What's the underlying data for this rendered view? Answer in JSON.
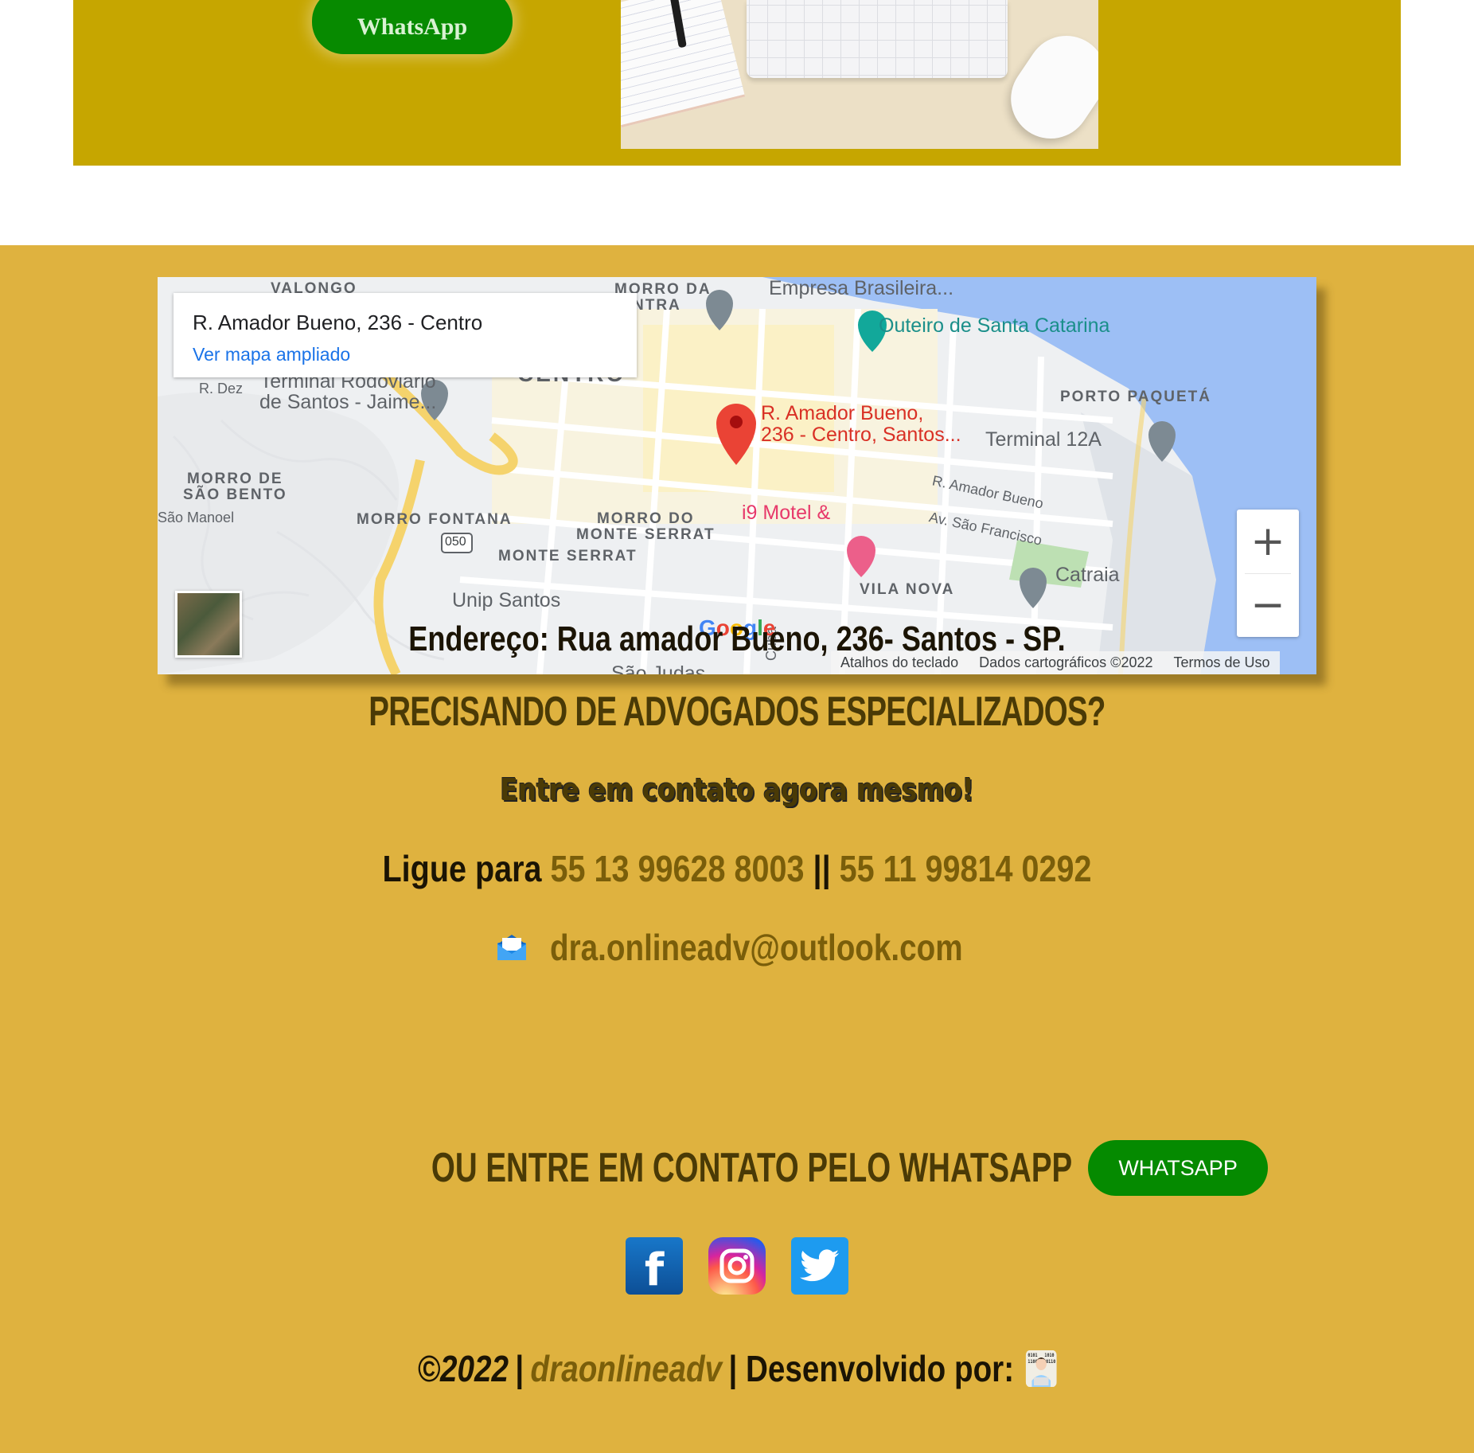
{
  "top_banner": {
    "whatsapp_button": "WhatsApp",
    "colors": {
      "banner": "#c6a600",
      "button": "#078a00"
    }
  },
  "map": {
    "info_address": "R. Amador Bueno, 236 - Centro",
    "info_link": "Ver mapa ampliado",
    "labels": {
      "valongo": "VALONGO",
      "morro_da_cintra": "MORRO DA\nCINTRA",
      "empresa": "Empresa Brasileira...",
      "outeiro": "Outeiro de Santa Catarina",
      "centro": "CENTRO",
      "terminal_rodoviario": "Terminal Rodoviário\nde Santos - Jaime...",
      "r_dez": "R. Dez",
      "porto_paqueta": "PORTO PAQUETÁ",
      "pin_label": "R. Amador Bueno,\n236 - Centro, Santos...",
      "terminal_12a": "Terminal 12A",
      "morro_sao_bento": "MORRO DE\nSÃO BENTO",
      "route_050": "050",
      "sao_manoel": "São Manoel",
      "morro_fontana": "MORRO FONTANA",
      "morro_monte_serrat": "MORRO DO\nMONTE SERRAT",
      "i9_motel": "i9 Motel &",
      "r_amador_bueno": "R. Amador Bueno",
      "av_sao_francisco": "Av. São Francisco",
      "monte_serrat": "MONTE SERRAT",
      "catraia": "Catraia",
      "vila_nova": "VILA NOVA",
      "unip": "Unip Santos",
      "sao_judas": "São Judas",
      "cuba": "Cuba"
    },
    "google_logo": "Google",
    "attribution": {
      "shortcuts": "Atalhos do teclado",
      "data": "Dados cartográficos ©2022",
      "terms": "Termos de Uso"
    },
    "zoom_in": "+",
    "zoom_out": "−"
  },
  "contact": {
    "address": "Endereço: Rua amador Bueno, 236- Santos - SP.",
    "headline": "PRECISANDO DE ADVOGADOS ESPECIALIZADOS?",
    "subhead": "Entre em contato agora mesmo!",
    "call_prefix": "Ligue para",
    "phone_1": "55 13 99628 8003",
    "phone_separator": "||",
    "phone_2": "55 11 99814 0292",
    "email": "dra.onlineadv@outlook.com",
    "whatsapp_prompt": "OU ENTRE EM CONTATO PELO WHATSAPP",
    "whatsapp_button": "WHATSAPP"
  },
  "social": {
    "facebook_glyph": "f",
    "icons": [
      "facebook-icon",
      "instagram-icon",
      "twitter-icon"
    ]
  },
  "footer": {
    "year": "©2022",
    "separator": "|",
    "brand": "draonlineadv",
    "developed_by": "| Desenvolvido por:"
  },
  "colors": {
    "footer_bg": "#dfb23f",
    "dark_text": "#1b1404",
    "gold_text": "#7a5e0a",
    "headline": "#4a3a06",
    "whatsapp_green": "#058a00"
  }
}
